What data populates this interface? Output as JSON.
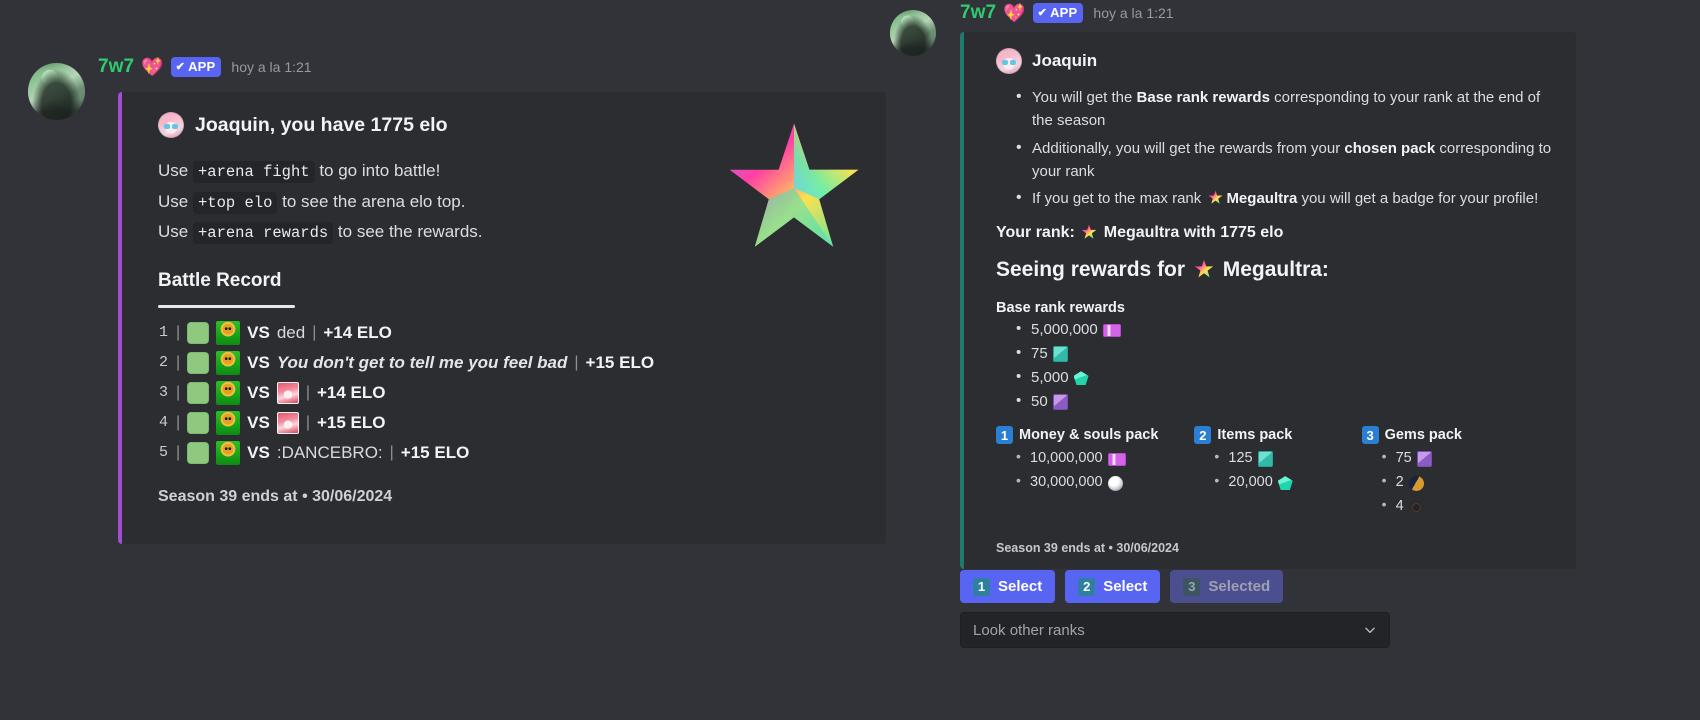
{
  "left_message": {
    "username": "7w7",
    "heart_emoji": "💖",
    "app_badge": "APP",
    "timestamp": "hoy a la 1:21",
    "embed": {
      "author_name": "Joaquin, you have 1775 elo",
      "command_lines": [
        {
          "pre": "Use ",
          "code": "+arena fight",
          "post": " to go into battle!"
        },
        {
          "pre": "Use ",
          "code": "+top elo",
          "post": " to see the arena elo top."
        },
        {
          "pre": "Use ",
          "code": "+arena rewards",
          "post": " to see the rewards."
        }
      ],
      "section_title": "Battle Record",
      "battles": [
        {
          "index": "1",
          "opponent": "ded",
          "opponent_style": "text",
          "elo": "+14 ELO"
        },
        {
          "index": "2",
          "opponent": "You don't get to tell me you feel bad",
          "opponent_style": "italic",
          "elo": "+15 ELO"
        },
        {
          "index": "3",
          "opponent": "",
          "opponent_style": "avatar",
          "elo": "+14 ELO"
        },
        {
          "index": "4",
          "opponent": "",
          "opponent_style": "avatar",
          "elo": "+15 ELO"
        },
        {
          "index": "5",
          "opponent": ":DANCEBRO:",
          "opponent_style": "text",
          "elo": "+15 ELO"
        }
      ],
      "vs_label": "VS",
      "separator": "|",
      "footer": "Season 39 ends at • 30/06/2024",
      "thumbnail": "rainbow-star",
      "accent_color": "#a44dd4"
    }
  },
  "right_message": {
    "username": "7w7",
    "heart_emoji": "💖",
    "app_badge": "APP",
    "timestamp": "hoy a la 1:21",
    "embed": {
      "author_name": "Joaquin",
      "accent_color": "#1f7a6b",
      "bullets": [
        {
          "parts": [
            {
              "t": "You will get the ",
              "b": false
            },
            {
              "t": "Base rank rewards",
              "b": true
            },
            {
              "t": " corresponding to your rank at the end of the season",
              "b": false
            }
          ]
        },
        {
          "parts": [
            {
              "t": "Additionally, you will get the rewards from your ",
              "b": false
            },
            {
              "t": "chosen pack",
              "b": true
            },
            {
              "t": " corresponding to your rank",
              "b": false
            }
          ]
        },
        {
          "parts": [
            {
              "t": "If you get to the max rank ",
              "b": false
            },
            {
              "t": "⭐",
              "b": false,
              "icon": "rainbow-star"
            },
            {
              "t": "Megaultra",
              "b": true
            },
            {
              "t": " you will get a badge for your profile!",
              "b": false
            }
          ]
        }
      ],
      "your_rank_prefix": "Your rank:",
      "your_rank_name": "Megaultra",
      "your_rank_suffix": "with 1775 elo",
      "seeing_prefix": "Seeing rewards for",
      "seeing_rank": "Megaultra:",
      "base_title": "Base rank rewards",
      "base_rewards": [
        {
          "amount": "5,000,000",
          "icon": "money-icon"
        },
        {
          "amount": "75",
          "icon": "teal-box-icon"
        },
        {
          "amount": "5,000",
          "icon": "gem-icon"
        },
        {
          "amount": "50",
          "icon": "purple-box-icon"
        }
      ],
      "packs": [
        {
          "number": "1",
          "name": "Money & souls pack",
          "items": [
            {
              "amount": "10,000,000",
              "icon": "money-icon"
            },
            {
              "amount": "30,000,000",
              "icon": "soul-icon"
            }
          ]
        },
        {
          "number": "2",
          "name": "Items pack",
          "items": [
            {
              "amount": "125",
              "icon": "teal-box-icon"
            },
            {
              "amount": "20,000",
              "icon": "gem-icon"
            }
          ]
        },
        {
          "number": "3",
          "name": "Gems pack",
          "items": [
            {
              "amount": "75",
              "icon": "purple-box-icon"
            },
            {
              "amount": "2",
              "icon": "moon-icon"
            },
            {
              "amount": "4",
              "icon": "ring-icon"
            }
          ]
        }
      ],
      "footer": "Season 39 ends at • 30/06/2024"
    },
    "buttons": [
      {
        "number": "1",
        "label": "Select",
        "state": "enabled"
      },
      {
        "number": "2",
        "label": "Select",
        "state": "enabled"
      },
      {
        "number": "3",
        "label": "Selected",
        "state": "disabled"
      }
    ],
    "select_menu": {
      "placeholder": "Look other ranks",
      "chevron": "chevron-down-icon"
    }
  },
  "colors": {
    "background": "#313338",
    "embed_bg": "#2b2d31",
    "blurple": "#5865f2",
    "username_green": "#2ecc71",
    "left_accent": "#a44dd4",
    "right_accent": "#1f7a6b"
  }
}
